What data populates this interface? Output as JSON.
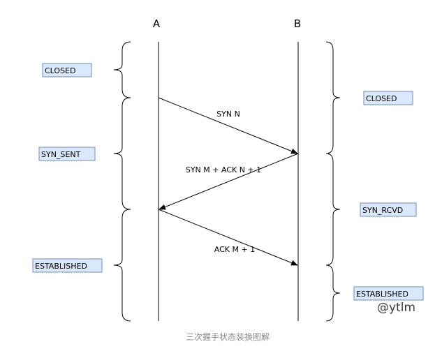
{
  "diagram": {
    "peer_a": "A",
    "peer_b": "B",
    "states_a": [
      "CLOSED",
      "SYN_SENT",
      "ESTABLISHED"
    ],
    "states_b": [
      "CLOSED",
      "SYN_RCVD",
      "ESTABLISHED"
    ],
    "messages": [
      "SYN N",
      "SYN M + ACK N + 1",
      "ACK M + 1"
    ],
    "watermark": "@ytlm",
    "caption": "三次握手状态装换图解"
  },
  "colors": {
    "state_box_fill": "#dae8fc",
    "state_box_stroke": "#6c8ebf",
    "line": "#000000",
    "caption": "#8c8c8c"
  }
}
